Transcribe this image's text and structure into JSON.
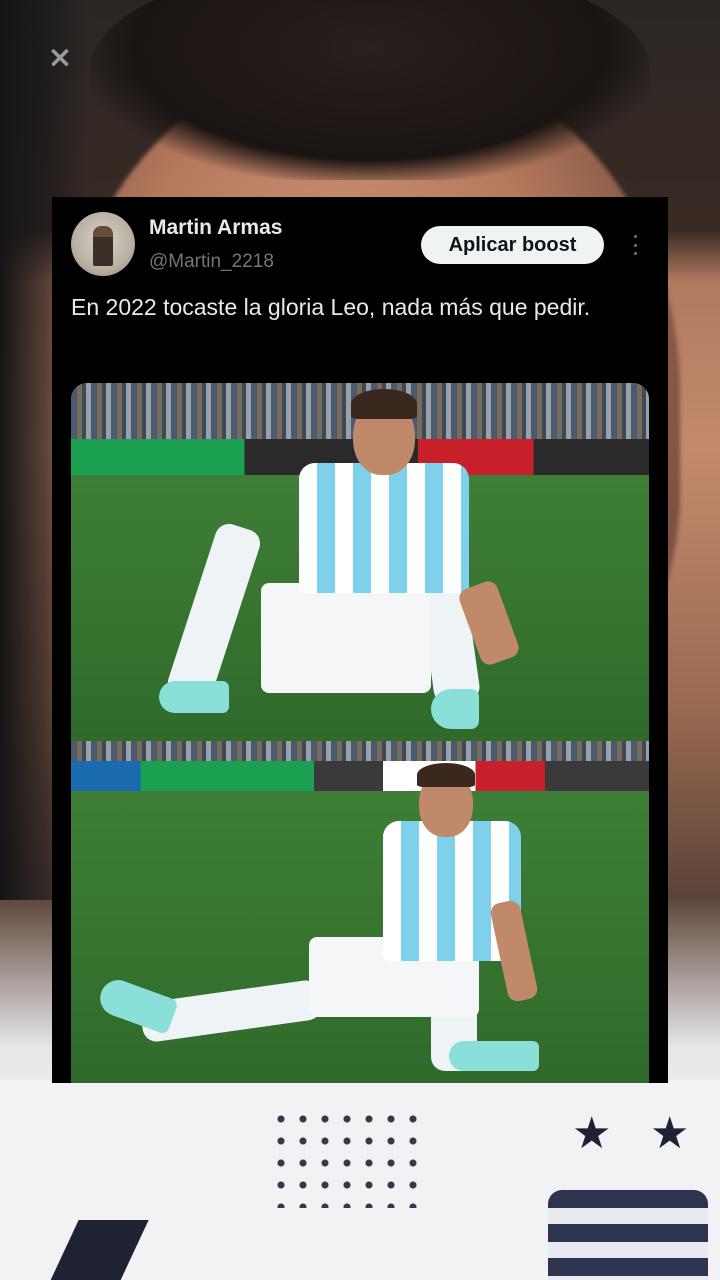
{
  "overlay": {
    "capcut_icon": "capcut-logo-icon"
  },
  "tweet": {
    "author_name": "Martin Armas",
    "author_handle": "@Martin_2218",
    "boost_label": "Aplicar boost",
    "text": "En 2022 tocaste la gloria Leo, nada más que pedir.",
    "more_icon": "more-vertical-icon"
  },
  "media": {
    "photos": 2
  }
}
